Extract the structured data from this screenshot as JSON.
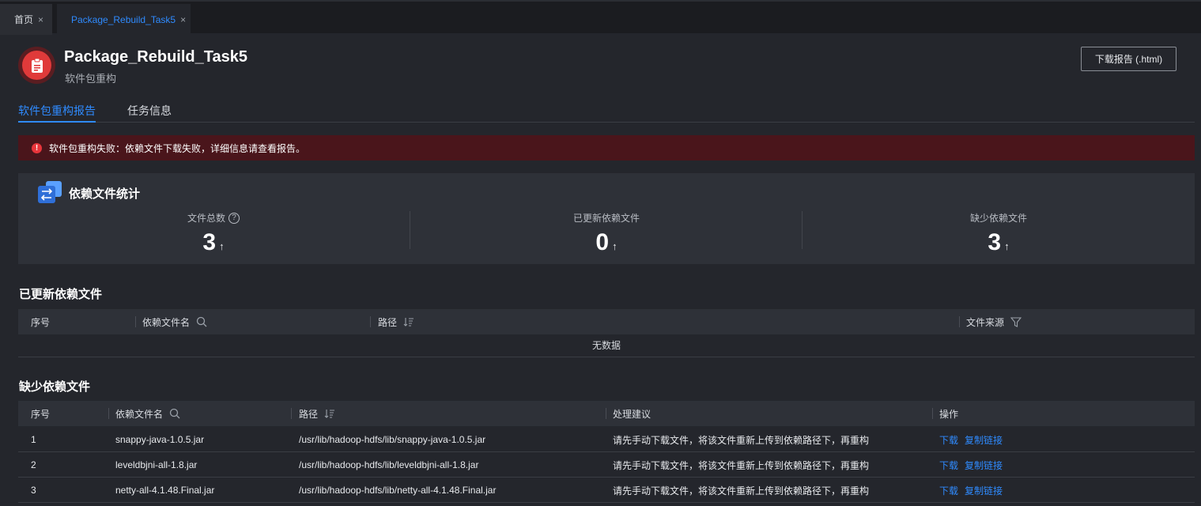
{
  "tabs": [
    {
      "label": "首页",
      "close": "×"
    },
    {
      "label": "Package_Rebuild_Task5",
      "close": "×"
    }
  ],
  "header": {
    "title": "Package_Rebuild_Task5",
    "subtitle": "软件包重构",
    "icon": "clipboard-icon",
    "download_label": "下载报告 (.html)"
  },
  "subtabs": [
    "软件包重构报告",
    "任务信息"
  ],
  "alert": {
    "icon": "!",
    "text": "软件包重构失败：依赖文件下载失败，详细信息请查看报告。",
    "color": "#4a151b"
  },
  "stats": {
    "title": "依赖文件统计",
    "items": [
      {
        "label": "文件总数",
        "value": "3",
        "arrow": "↑",
        "help": "?"
      },
      {
        "label": "已更新依赖文件",
        "value": "0",
        "arrow": "↑"
      },
      {
        "label": "缺少依赖文件",
        "value": "3",
        "arrow": "↑"
      }
    ]
  },
  "updated": {
    "title": "已更新依赖文件",
    "columns": [
      "序号",
      "依赖文件名",
      "路径",
      "文件来源"
    ],
    "empty_text": "无数据"
  },
  "missing": {
    "title": "缺少依赖文件",
    "columns": [
      "序号",
      "依赖文件名",
      "路径",
      "处理建议",
      "操作"
    ],
    "rows": [
      {
        "index": "1",
        "name": "snappy-java-1.0.5.jar",
        "path": "/usr/lib/hadoop-hdfs/lib/snappy-java-1.0.5.jar",
        "advice": "请先手动下载文件，将该文件重新上传到依赖路径下，再重构",
        "action1": "下载",
        "action2": "复制链接"
      },
      {
        "index": "2",
        "name": "leveldbjni-all-1.8.jar",
        "path": "/usr/lib/hadoop-hdfs/lib/leveldbjni-all-1.8.jar",
        "advice": "请先手动下载文件，将该文件重新上传到依赖路径下，再重构",
        "action1": "下载",
        "action2": "复制链接"
      },
      {
        "index": "3",
        "name": "netty-all-4.1.48.Final.jar",
        "path": "/usr/lib/hadoop-hdfs/lib/netty-all-4.1.48.Final.jar",
        "advice": "请先手动下载文件，将该文件重新上传到依赖路径下，再重构",
        "action1": "下载",
        "action2": "复制链接"
      }
    ]
  },
  "colors": {
    "accent": "#2f8bff",
    "error": "#e03a3a"
  }
}
